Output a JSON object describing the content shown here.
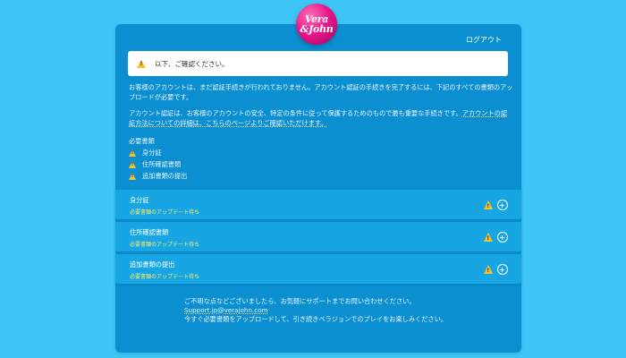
{
  "logo": {
    "line1": "Vera",
    "line2": "&John"
  },
  "header": {
    "logout": "ログアウト"
  },
  "notice": {
    "icon": "warning-icon",
    "text": "以下、ご確認ください。"
  },
  "intro": {
    "p1": "お客様のアカウントは、まだ認証手続きが行われておりません。アカウント認証の手続きを完了するには、下記のすべての書類のアップロードが必要です。",
    "p2_a": "アカウント認証は、お客様のアカウントの安全、特定の条件に従って保護するためのもので最も重要な手続きです。",
    "p2_link": "アカウントの認証方法についての詳細は、こちらのページよりご確認いただけます。"
  },
  "required": {
    "title": "必要書類",
    "items": [
      "身分証",
      "住所確認書類",
      "追加書類の提出"
    ]
  },
  "documents": [
    {
      "title": "身分証",
      "status": "必要書類のアップデート待ち"
    },
    {
      "title": "住所確認書類",
      "status": "必要書類のアップデート待ち"
    },
    {
      "title": "追加書類の提出",
      "status": "必要書類のアップデート待ち"
    }
  ],
  "footer": {
    "line1": "ご不明な点などございましたら、お気軽にサポートまでお問い合わせください。",
    "email": "Support.jp@verajohn.com",
    "line3": "今すぐ必要書類をアップロードして、引き続きベラジョンでのプレイをお楽しみください。"
  },
  "colors": {
    "background": "#3dc5f5",
    "panel": "#0c8fd0",
    "row": "#17a6e3",
    "warning": "#f6c12c",
    "status": "#ffe96a"
  }
}
